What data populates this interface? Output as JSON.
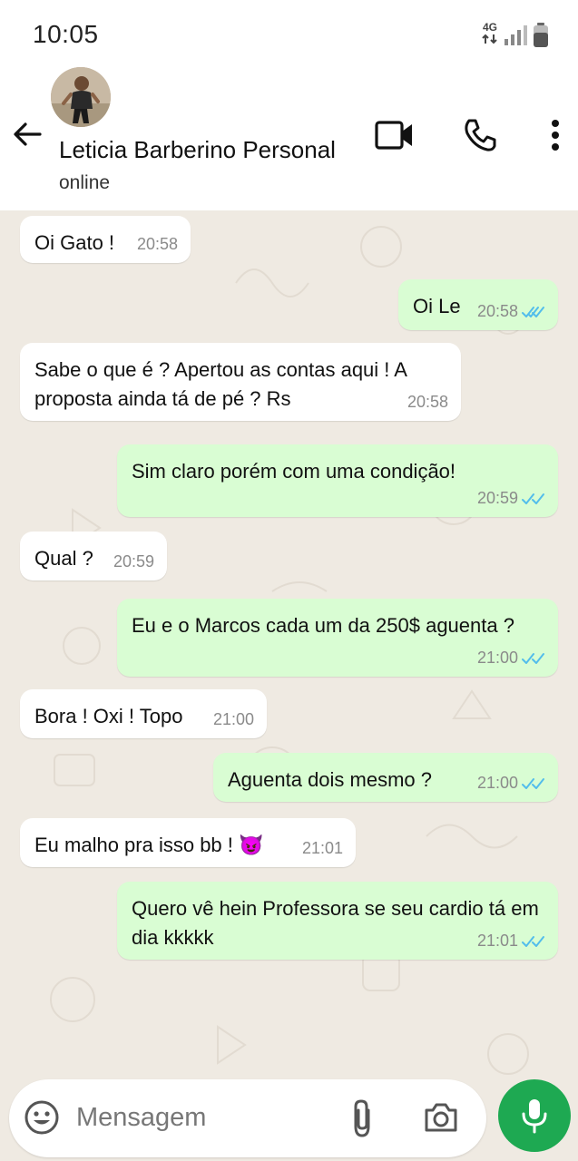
{
  "status_bar": {
    "time": "10:05",
    "network": "4G"
  },
  "header": {
    "contact_name": "Leticia Barberino Personal",
    "contact_status": "online",
    "icons": [
      "back-arrow-icon",
      "video-call-icon",
      "phone-icon",
      "more-options-icon"
    ]
  },
  "messages": [
    {
      "direction": "incoming",
      "text": "Oi Gato !",
      "time": "20:58"
    },
    {
      "direction": "outgoing",
      "text": "Oi Le",
      "time": "20:58",
      "status": "read"
    },
    {
      "direction": "incoming",
      "text": "Sabe o que é ? Apertou as contas aqui ! A proposta ainda tá de pé ? Rs",
      "time": "20:58"
    },
    {
      "direction": "outgoing",
      "text": "Sim claro porém com uma condição!",
      "time": "20:59",
      "status": "read"
    },
    {
      "direction": "incoming",
      "text": "Qual ?",
      "time": "20:59"
    },
    {
      "direction": "outgoing",
      "text": "Eu e o Marcos cada um da 250$ aguenta ?",
      "time": "21:00",
      "status": "read"
    },
    {
      "direction": "incoming",
      "text": "Bora ! Oxi ! Topo",
      "time": "21:00"
    },
    {
      "direction": "outgoing",
      "text": "Aguenta dois mesmo ?",
      "time": "21:00",
      "status": "read"
    },
    {
      "direction": "incoming",
      "text": "Eu malho pra isso bb ! 😈",
      "time": "21:01"
    },
    {
      "direction": "outgoing",
      "text": "Quero vê hein Professora se seu cardio tá em dia kkkkk",
      "time": "21:01",
      "status": "read"
    }
  ],
  "composer": {
    "placeholder": "Mensagem"
  },
  "colors": {
    "chat_background": "#efeae2",
    "outgoing_bubble": "#d9fdd3",
    "incoming_bubble": "#ffffff",
    "read_ticks": "#53bdeb",
    "mic_button": "#1ea952"
  }
}
